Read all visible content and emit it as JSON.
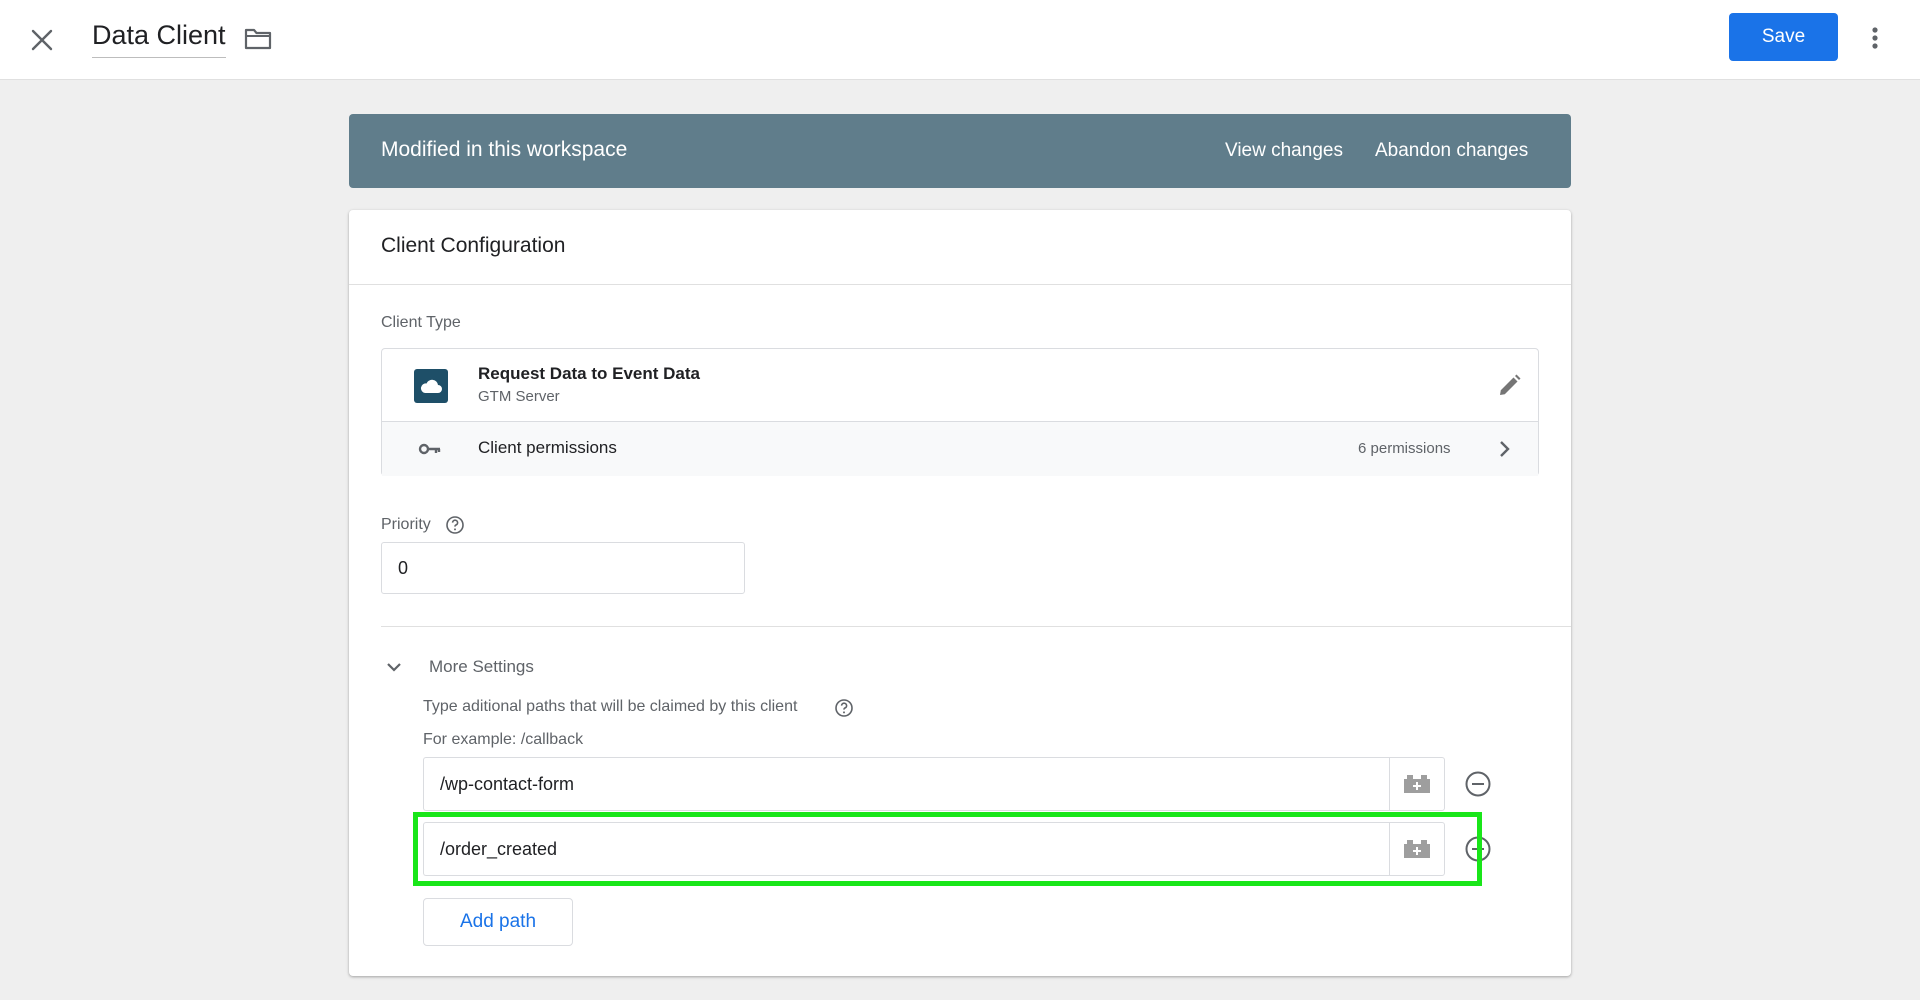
{
  "header": {
    "title": "Data Client",
    "save_label": "Save"
  },
  "banner": {
    "text": "Modified in this workspace",
    "view_changes": "View changes",
    "abandon_changes": "Abandon changes"
  },
  "card": {
    "title": "Client Configuration",
    "client_type_label": "Client Type",
    "client_type": {
      "name": "Request Data to Event Data",
      "source": "GTM Server"
    },
    "permissions": {
      "label": "Client permissions",
      "count": "6 permissions"
    },
    "priority": {
      "label": "Priority",
      "value": "0"
    },
    "more_settings": {
      "label": "More Settings",
      "description": "Type aditional paths that will be claimed by this client",
      "example": "For example: /callback",
      "paths": [
        "/wp-contact-form",
        "/order_created"
      ],
      "add_path_label": "Add path"
    }
  },
  "colors": {
    "accent": "#1a73e8",
    "banner": "#607d8b",
    "highlight": "#19e619"
  },
  "icons": [
    "close-icon",
    "folder-icon",
    "more-vert-icon",
    "cloud-icon",
    "edit-icon",
    "key-icon",
    "chevron-right-icon",
    "help-icon",
    "chevron-down-icon",
    "variable-icon",
    "remove-circle-icon"
  ]
}
